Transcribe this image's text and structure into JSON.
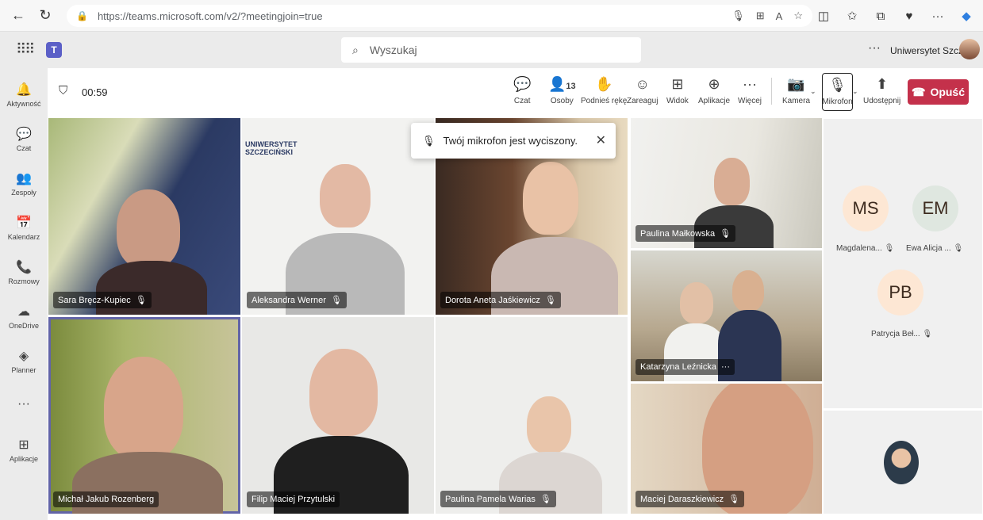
{
  "browser": {
    "url": "https://teams.microsoft.com/v2/?meetingjoin=true",
    "back_icon": "arrow-left-icon",
    "refresh_icon": "refresh-icon"
  },
  "header": {
    "search_placeholder": "Wyszukaj",
    "org_name": "Uniwersytet Szcz...",
    "more": "···"
  },
  "rail": [
    {
      "label": "Aktywność",
      "icon": "🔔"
    },
    {
      "label": "Czat",
      "icon": "💬"
    },
    {
      "label": "Zespoły",
      "icon": "👥"
    },
    {
      "label": "Kalendarz",
      "icon": "📅"
    },
    {
      "label": "Rozmowy",
      "icon": "📞"
    },
    {
      "label": "OneDrive",
      "icon": "☁"
    },
    {
      "label": "Planner",
      "icon": "◈"
    },
    {
      "label": "Aplikacje",
      "icon": "⊞"
    }
  ],
  "meeting": {
    "timer": "00:59",
    "toolbar": {
      "chat": "Czat",
      "people": "Osoby",
      "people_count": "13",
      "raise_hand": "Podnieś rękę",
      "react": "Zareaguj",
      "view": "Widok",
      "apps": "Aplikacje",
      "more": "Więcej",
      "camera": "Kamera",
      "mic": "Mikrofon",
      "share": "Udostępnij",
      "leave": "Opuść"
    },
    "toast": "Twój mikrofon jest wyciszony.",
    "tile_logo_line1": "UNIWERSYTET",
    "tile_logo_line2": "SZCZECIŃSKI",
    "participants": [
      {
        "name": "Sara Bręcz-Kupiec"
      },
      {
        "name": "Aleksandra Werner"
      },
      {
        "name": "Dorota Aneta Jaśkiewicz"
      },
      {
        "name": "Paulina Małkowska"
      },
      {
        "name": "Katarzyna Leźnicka"
      },
      {
        "name": "Michał Jakub Rozenberg"
      },
      {
        "name": "Filip Maciej Przytulski"
      },
      {
        "name": "Paulina Pamela Warias"
      },
      {
        "name": "Maciej Daraszkiewicz"
      }
    ],
    "side": [
      {
        "initials": "MS",
        "name": "Magdalena...",
        "color": "#fde7d4"
      },
      {
        "initials": "EM",
        "name": "Ewa Alicja ...",
        "color": "#dfe7e0"
      },
      {
        "initials": "PB",
        "name": "Patrycja Beł...",
        "color": "#fde7d4"
      }
    ]
  }
}
